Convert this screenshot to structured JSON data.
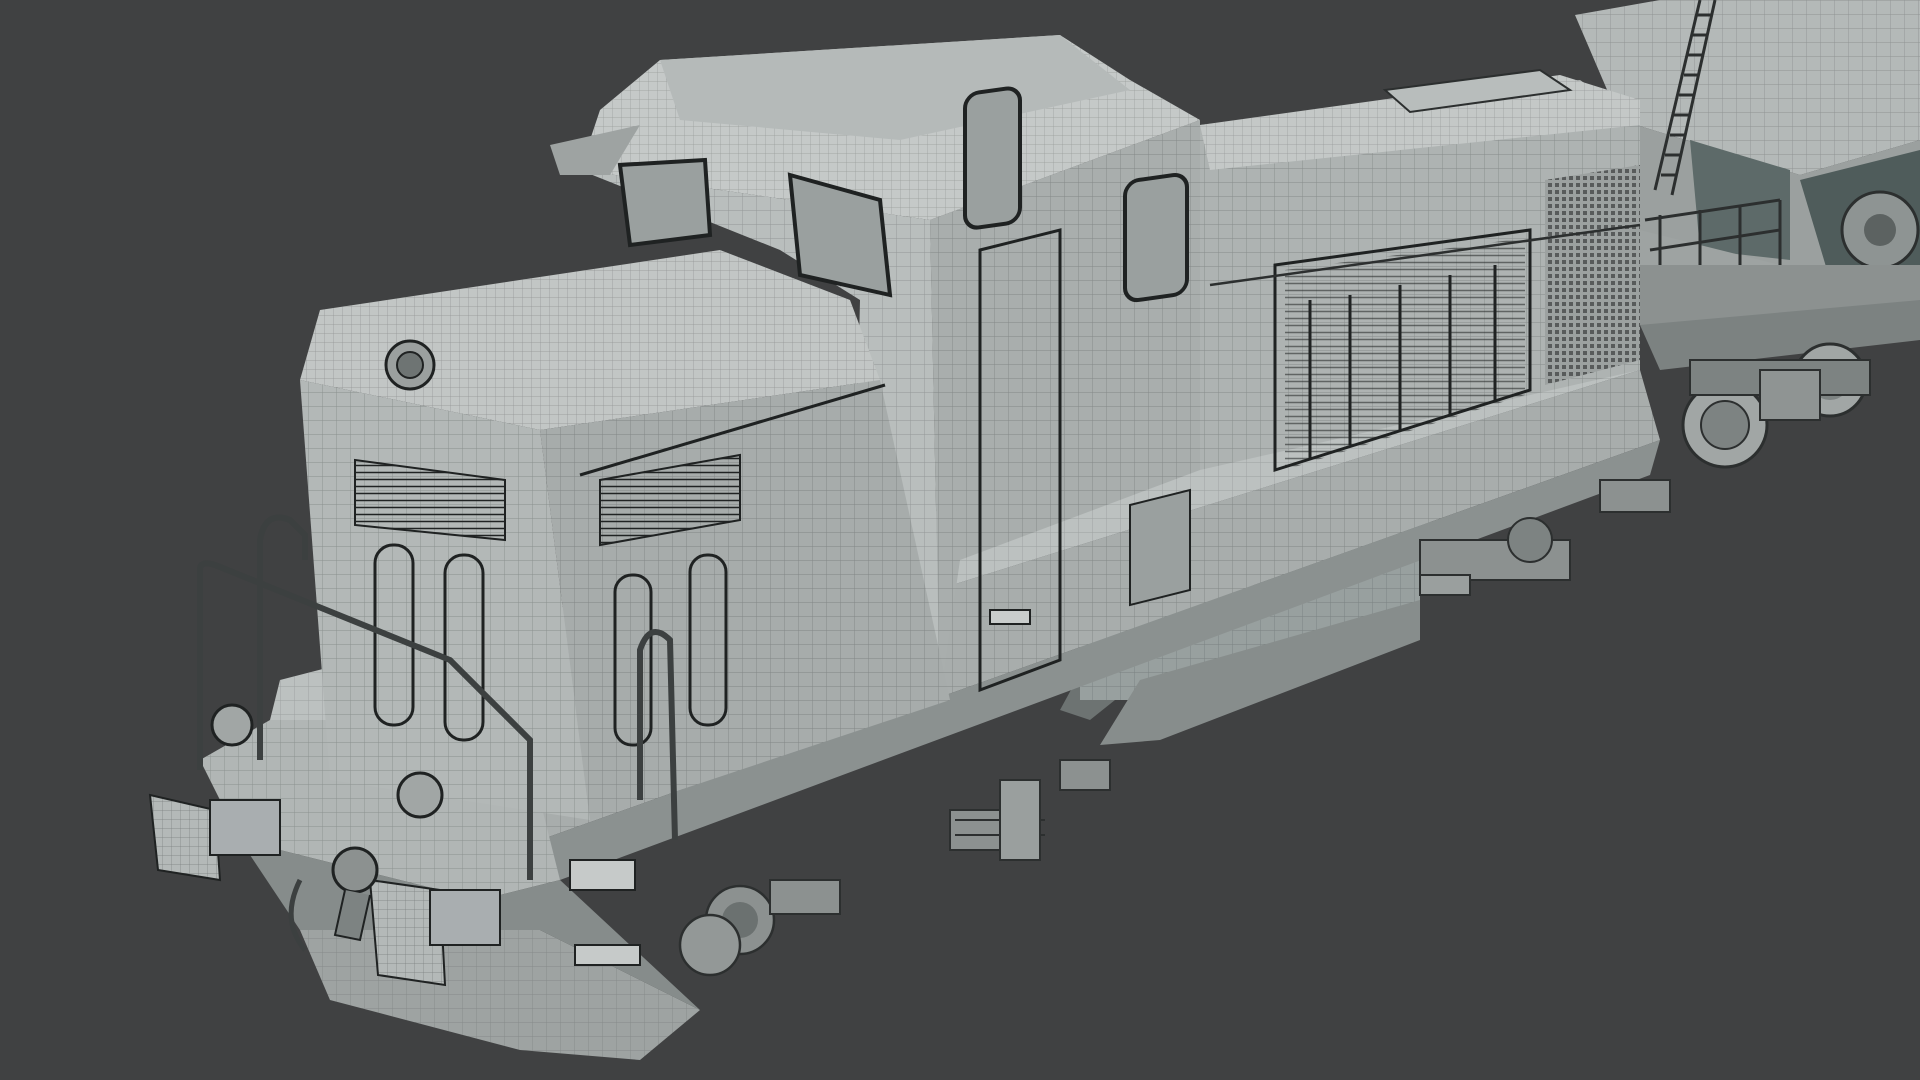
{
  "scene": {
    "background_color": "#404142",
    "mesh_color": "#a6abaa",
    "mesh_light": "#c2c6c5",
    "mesh_shadow": "#7e8483",
    "wire_color": "#2c2f2f",
    "objects": [
      {
        "name": "diesel-locomotive-wireframe"
      },
      {
        "name": "hopper-wagon-wireframe"
      }
    ]
  }
}
